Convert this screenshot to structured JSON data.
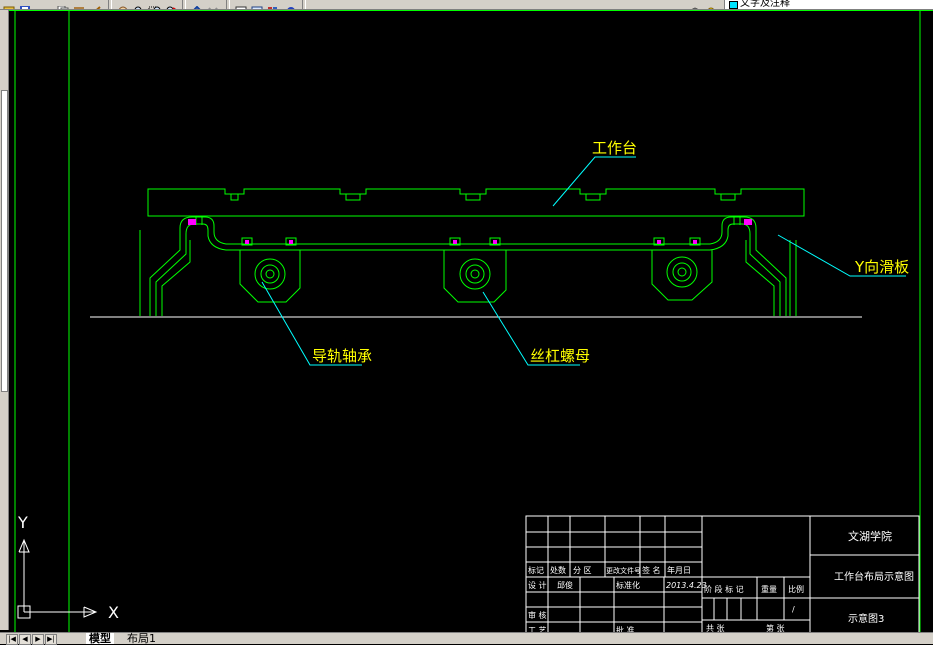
{
  "toolbar": {
    "icons": [
      "open-icon",
      "save-icon",
      "cut-icon",
      "copy-icon",
      "paste-icon",
      "match-icon",
      "pan-icon",
      "zoom-icon",
      "zoom-window-icon",
      "zoom-previous-icon",
      "undo-icon",
      "redo-icon",
      "properties-icon",
      "design-center-icon",
      "tool-palette-icon",
      "help-icon",
      "layer-icon",
      "layer-state-icon"
    ],
    "layer_name": "文字及注释"
  },
  "colors": {
    "frame": "#00ff00",
    "title_block": "#ffffff",
    "bolts": "#ff00ff",
    "leader": "#00ffff",
    "labels": "#ffff00"
  },
  "drawing": {
    "labels": {
      "worktable": "工作台",
      "y_slide": "Y向滑板",
      "guide_bearing": "导轨轴承",
      "screw_nut": "丝杠螺母"
    },
    "ucs": {
      "x": "X",
      "y": "Y"
    }
  },
  "title_block": {
    "school": "文湖学院",
    "title": "工作台布局示意图",
    "drawing_no": "示意图3",
    "row_labels": [
      "标记",
      "处数",
      "分 区",
      "更改文件号",
      "签 名",
      "年月日"
    ],
    "designer_label": "设 计",
    "designer": "邱俊",
    "standardize_label": "标准化",
    "date": "2013.4.23",
    "stage_label": "阶 段 标 记",
    "weight_label": "重量",
    "scale_label": "比例",
    "review_label": "审 核",
    "process_label": "工 艺",
    "approve_label": "批 准",
    "sheet_label": "共 张",
    "sheet_of": "第 张",
    "scale_value": "/"
  },
  "tabs": {
    "nav": [
      "|◀",
      "◀",
      "▶",
      "▶|"
    ],
    "model": "模型",
    "layout1": "布局1"
  }
}
